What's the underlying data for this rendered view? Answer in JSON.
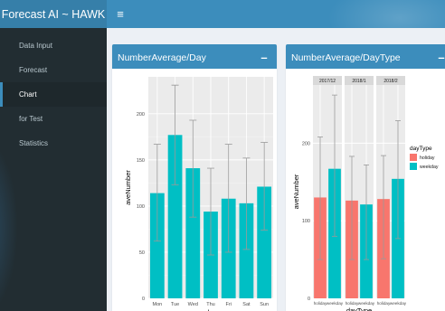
{
  "app": {
    "title": "Forecast AI ~ HAWK"
  },
  "header": {
    "toggle_glyph": "≡"
  },
  "sidebar": {
    "items": [
      {
        "label": "Data Input",
        "active": false
      },
      {
        "label": "Forecast",
        "active": false
      },
      {
        "label": "Chart",
        "active": true
      },
      {
        "label": "for Test",
        "active": false
      },
      {
        "label": "Statistics",
        "active": false
      }
    ]
  },
  "boxes": {
    "left": {
      "title": "NumberAverage/Day",
      "collapse_glyph": "–"
    },
    "right": {
      "title": "NumberAverage/DayType",
      "collapse_glyph": "–"
    }
  },
  "colors": {
    "header": "#3c8dbc",
    "logo": "#367fa9",
    "sidebar": "#222d32",
    "bar_teal": "#00bfc4",
    "bar_red": "#f8766d",
    "panel_bg": "#ebebeb"
  },
  "chart_data": [
    {
      "type": "bar",
      "xlabel": "day",
      "ylabel": "aveNumber",
      "categories": [
        "Mon",
        "Tue",
        "Wed",
        "Thu",
        "Fri",
        "Sat",
        "Sun"
      ],
      "values": [
        114,
        177,
        141,
        94,
        108,
        103,
        121
      ],
      "error_low": [
        62,
        123,
        88,
        47,
        50,
        53,
        74
      ],
      "error_high": [
        167,
        231,
        193,
        141,
        167,
        152,
        169
      ],
      "yticks": [
        0,
        50,
        100,
        150,
        200
      ],
      "ylim": [
        0,
        240
      ],
      "grid": true
    },
    {
      "type": "bar",
      "xlabel": "dayType",
      "ylabel": "aveNumber",
      "facets": [
        "2017/12",
        "2018/1",
        "2018/2"
      ],
      "categories": [
        "holiday",
        "weekday"
      ],
      "series": [
        {
          "facet": "2017/12",
          "values": [
            130,
            167
          ],
          "error_low": [
            50,
            80
          ],
          "error_high": [
            208,
            262
          ]
        },
        {
          "facet": "2018/1",
          "values": [
            126,
            121
          ],
          "error_low": [
            50,
            50
          ],
          "error_high": [
            183,
            172
          ]
        },
        {
          "facet": "2018/2",
          "values": [
            128,
            154
          ],
          "error_low": [
            51,
            77
          ],
          "error_high": [
            184,
            229
          ]
        }
      ],
      "yticks": [
        0,
        100,
        200
      ],
      "ylim": [
        0,
        275
      ],
      "legend": {
        "title": "dayType",
        "entries": [
          "holiday",
          "weekday"
        ],
        "position": "right"
      },
      "grid": true
    }
  ]
}
